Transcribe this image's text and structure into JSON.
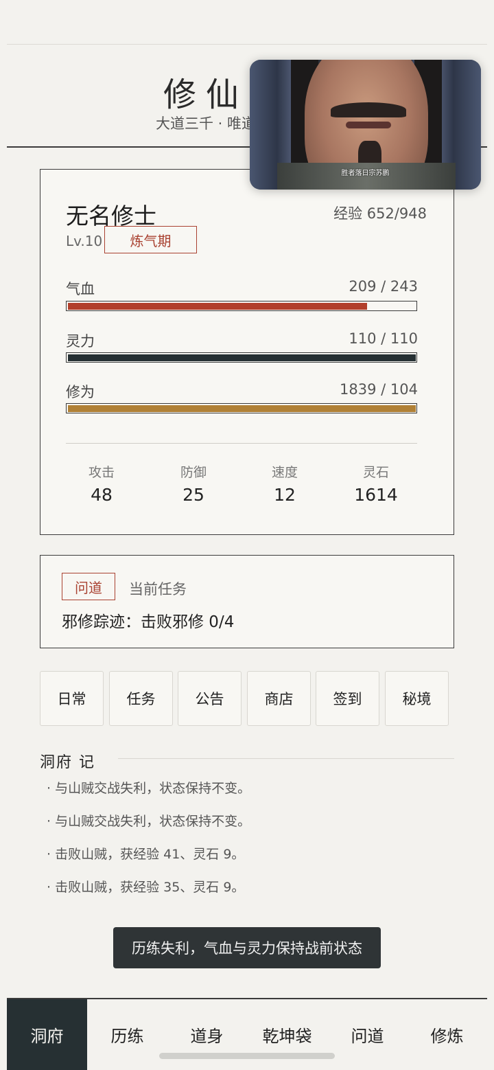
{
  "header": {
    "title": "修仙",
    "subtitle": "大道三千 · 唯道"
  },
  "video": {
    "caption": "胜者落日宗苏鹏"
  },
  "character": {
    "name": "无名修士",
    "level": "Lv.10",
    "realm": "炼气期",
    "exp": "经验 652/948",
    "stats": [
      {
        "label": "气血",
        "value": "209 / 243",
        "fraction": 0.86,
        "color": "#b23f2b"
      },
      {
        "label": "灵力",
        "value": "110 / 110",
        "fraction": 1.0,
        "color": "#263033"
      },
      {
        "label": "修为",
        "value": "1839 / 104",
        "fraction": 1.0,
        "color": "#b08035"
      }
    ],
    "attributes": [
      {
        "label": "攻击",
        "value": "48"
      },
      {
        "label": "防御",
        "value": "25"
      },
      {
        "label": "速度",
        "value": "12"
      },
      {
        "label": "灵石",
        "value": "1614"
      }
    ]
  },
  "task": {
    "tag": "问道",
    "label": "当前任务",
    "text": "邪修踪迹：击败邪修 0/4"
  },
  "actions": [
    "日常",
    "任务",
    "公告",
    "商店",
    "签到",
    "秘境"
  ],
  "log": {
    "title": "洞府 记",
    "items": [
      "· 与山贼交战失利，状态保持不变。",
      "· 与山贼交战失利，状态保持不变。",
      "· 击败山贼，获经验 41、灵石 9。",
      "· 击败山贼，获经验 35、灵石 9。"
    ]
  },
  "toast": "历练失利，气血与灵力保持战前状态",
  "nav": {
    "active": 0,
    "items": [
      "洞府",
      "历练",
      "道身",
      "乾坤袋",
      "问道",
      "修炼"
    ]
  }
}
